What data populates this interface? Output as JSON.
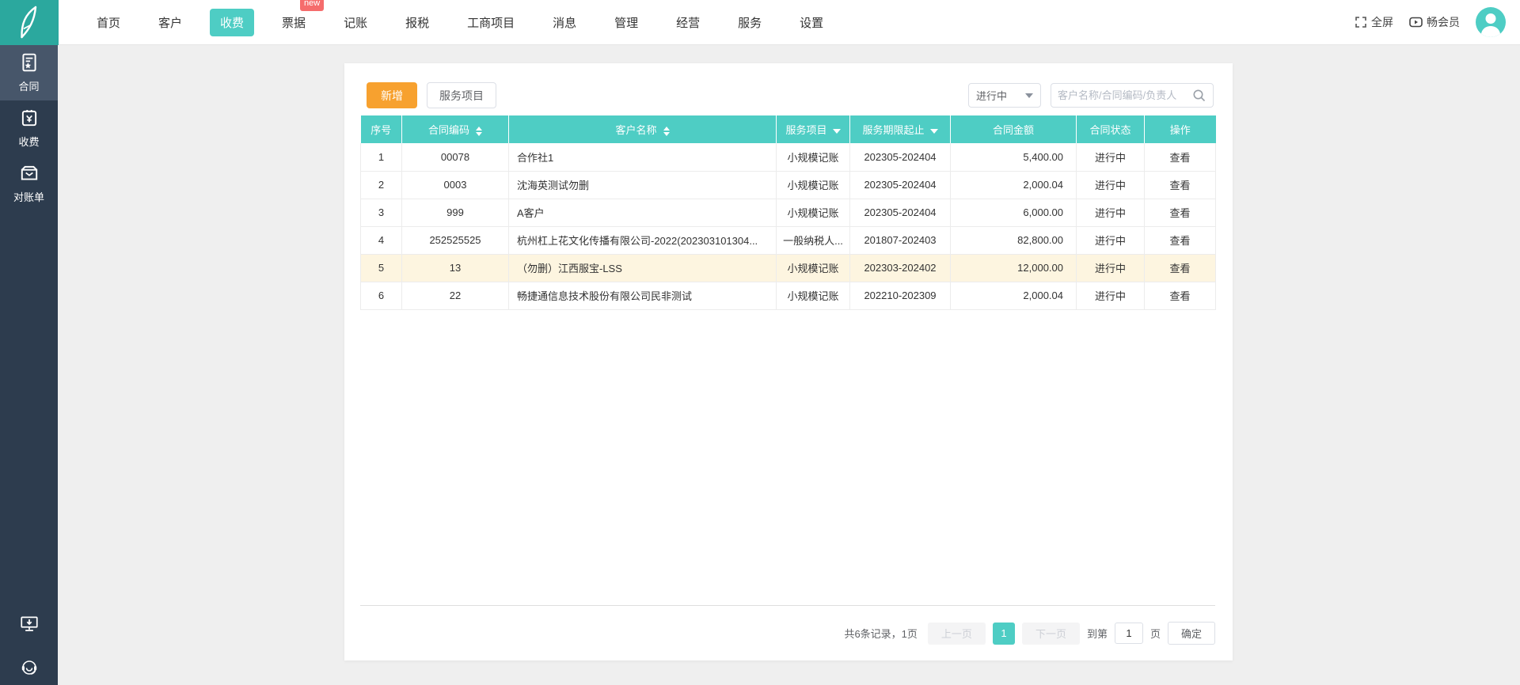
{
  "topbar": {
    "nav": [
      {
        "label": "首页",
        "active": false
      },
      {
        "label": "客户",
        "active": false
      },
      {
        "label": "收费",
        "active": true
      },
      {
        "label": "票据",
        "active": false,
        "badge": "new"
      },
      {
        "label": "记账",
        "active": false
      },
      {
        "label": "报税",
        "active": false
      },
      {
        "label": "工商项目",
        "active": false
      },
      {
        "label": "消息",
        "active": false
      },
      {
        "label": "管理",
        "active": false
      },
      {
        "label": "经营",
        "active": false
      },
      {
        "label": "服务",
        "active": false
      },
      {
        "label": "设置",
        "active": false
      }
    ],
    "fullscreen_label": "全屏",
    "member_label": "畅会员",
    "icons": [
      "logo-feather-icon",
      "fullscreen-icon",
      "member-video-icon",
      "avatar"
    ]
  },
  "sidebar": {
    "items": [
      {
        "label": "合同",
        "active": true,
        "icon": "contract-icon"
      },
      {
        "label": "收费",
        "active": false,
        "icon": "fee-icon"
      },
      {
        "label": "对账单",
        "active": false,
        "icon": "statement-icon"
      }
    ],
    "bottom_icons": [
      "client-download-icon",
      "customer-service-icon"
    ]
  },
  "toolbar": {
    "add_label": "新增",
    "service_items_label": "服务项目",
    "status_filter_value": "进行中",
    "search_placeholder": "客户名称/合同编码/负责人"
  },
  "table": {
    "columns": [
      {
        "label": "序号",
        "sort": "none"
      },
      {
        "label": "合同编码",
        "sort": "both"
      },
      {
        "label": "客户名称",
        "sort": "both"
      },
      {
        "label": "服务项目",
        "sort": "filter"
      },
      {
        "label": "服务期限起止",
        "sort": "filter"
      },
      {
        "label": "合同金额",
        "sort": "none"
      },
      {
        "label": "合同状态",
        "sort": "none"
      },
      {
        "label": "操作",
        "sort": "none"
      }
    ],
    "rows": [
      {
        "no": "1",
        "code": "00078",
        "customer": "合作社1",
        "service": "小规模记账",
        "period": "202305-202404",
        "amount": "5,400.00",
        "status": "进行中",
        "action": "查看",
        "highlight": false
      },
      {
        "no": "2",
        "code": "0003",
        "customer": "沈海英测试勿删",
        "service": "小规模记账",
        "period": "202305-202404",
        "amount": "2,000.04",
        "status": "进行中",
        "action": "查看",
        "highlight": false
      },
      {
        "no": "3",
        "code": "999",
        "customer": "A客户",
        "service": "小规模记账",
        "period": "202305-202404",
        "amount": "6,000.00",
        "status": "进行中",
        "action": "查看",
        "highlight": false
      },
      {
        "no": "4",
        "code": "252525525",
        "customer": "杭州杠上花文化传播有限公司-2022(202303101304...",
        "service": "一般纳税人...",
        "period": "201807-202403",
        "amount": "82,800.00",
        "status": "进行中",
        "action": "查看",
        "highlight": false
      },
      {
        "no": "5",
        "code": "13",
        "customer": "（勿删）江西服宝-LSS",
        "service": "小规模记账",
        "period": "202303-202402",
        "amount": "12,000.00",
        "status": "进行中",
        "action": "查看",
        "highlight": true
      },
      {
        "no": "6",
        "code": "22",
        "customer": "畅捷通信息技术股份有限公司民非测试",
        "service": "小规模记账",
        "period": "202210-202309",
        "amount": "2,000.04",
        "status": "进行中",
        "action": "查看",
        "highlight": false
      }
    ]
  },
  "pagination": {
    "summary": "共6条记录，1页",
    "prev": "上一页",
    "page": "1",
    "next": "下一页",
    "goto_prefix": "到第",
    "goto_value": "1",
    "goto_suffix": "页",
    "confirm": "确定"
  },
  "colors": {
    "accent_teal": "#4ecdc4",
    "logo_teal": "#2ba89e",
    "sidebar_bg": "#2d3c4e",
    "sidebar_active_bg": "#47566a",
    "add_button_orange": "#f7a12f",
    "new_badge_red": "#f56c6c",
    "row_highlight": "#fdf5e0",
    "main_bg": "#efefef"
  }
}
